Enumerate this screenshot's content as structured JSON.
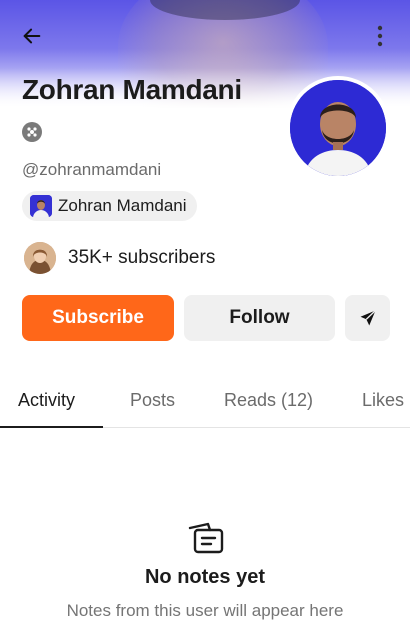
{
  "header": {
    "back_icon": "arrow-left-icon",
    "more_icon": "vertical-dots-icon"
  },
  "profile": {
    "name": "Zohran Mamdani",
    "handle": "@zohranmamdani",
    "verified_icon": "badge-icon",
    "publication": "Zohran Mamdani",
    "subscribers": "35K+ subscribers"
  },
  "actions": {
    "subscribe_label": "Subscribe",
    "follow_label": "Follow",
    "share_icon": "send-icon",
    "accent_color": "#ff6719"
  },
  "tabs": [
    {
      "label": "Activity",
      "active": true
    },
    {
      "label": "Posts",
      "active": false
    },
    {
      "label": "Reads (12)",
      "active": false
    },
    {
      "label": "Likes",
      "active": false
    }
  ],
  "empty_state": {
    "icon": "notes-icon",
    "title": "No notes yet",
    "subtitle": "Notes from this user will appear here"
  }
}
